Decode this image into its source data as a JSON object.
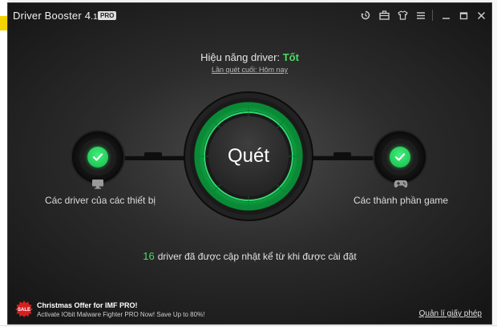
{
  "app": {
    "title": "Driver Booster 4.1",
    "title_main": "Driver Booster 4",
    "title_version": ".1",
    "badge": "PRO"
  },
  "toolbar": {
    "icons": [
      "history-icon",
      "toolbox-icon",
      "shirt-skin-icon",
      "menu-icon",
      "minimize-icon",
      "maximize-icon",
      "close-icon"
    ]
  },
  "status": {
    "label": "Hiệu năng driver:",
    "value": "Tốt",
    "last_scan": "Lần quét cuối: Hôm nay"
  },
  "scan": {
    "label": "Quét"
  },
  "left_section": {
    "label": "Các driver của các thiết bị",
    "icon": "monitor-icon"
  },
  "right_section": {
    "label": "Các thành phần game",
    "icon": "gamepad-icon"
  },
  "summary": {
    "count": "16",
    "text": "driver đã được cập nhật kể từ khi được cài đặt"
  },
  "promo": {
    "badge": "SALE",
    "title": "Christmas Offer for IMF PRO!",
    "subtitle": "Activate IObit Malware Fighter PRO Now! Save Up to 80%!"
  },
  "license": {
    "label": "Quản lí giấy phép"
  },
  "colors": {
    "accent_green": "#4cd964",
    "ring_green": "#2ee86e",
    "window_bg": "#2c2c2c"
  }
}
